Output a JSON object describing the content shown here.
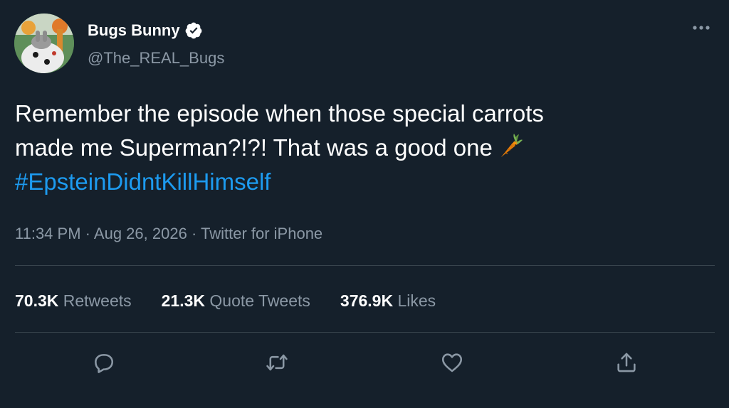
{
  "tweet": {
    "display_name": "Bugs Bunny",
    "handle": "@The_REAL_Bugs",
    "text_line1": "Remember the episode when those special carrots",
    "text_line2": "made me Superman?!?! That was a good one",
    "hashtag": "#EpsteinDidntKillHimself",
    "time": "11:34 PM",
    "date": "Aug 26, 2026",
    "source": "Twitter for iPhone",
    "separator": "·"
  },
  "stats": {
    "retweets_count": "70.3K",
    "retweets_label": "Retweets",
    "quotes_count": "21.3K",
    "quotes_label": "Quote Tweets",
    "likes_count": "376.9K",
    "likes_label": "Likes"
  },
  "icons": {
    "verified": "verified-badge-icon",
    "more": "more-options-icon",
    "carrot": "carrot-emoji",
    "reply": "reply-icon",
    "retweet": "retweet-icon",
    "like": "heart-icon",
    "share": "share-icon"
  },
  "colors": {
    "background": "#15202b",
    "text_primary": "#ffffff",
    "text_secondary": "#8b98a5",
    "accent": "#1d9bf0",
    "divider": "#38444d"
  }
}
